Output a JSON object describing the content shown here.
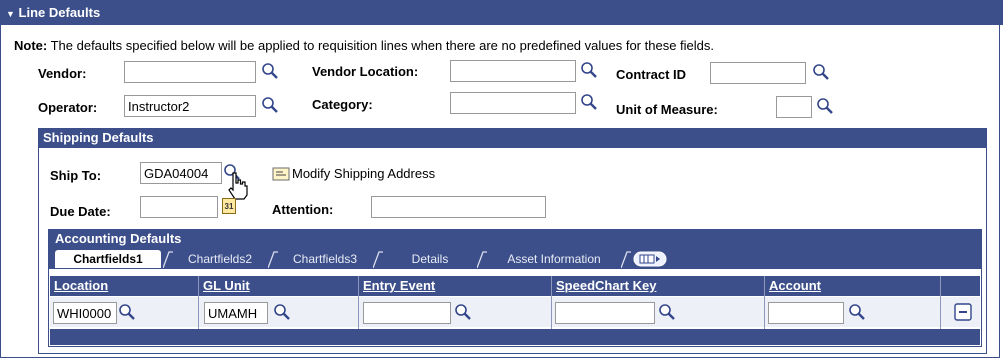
{
  "section": {
    "title": "Line Defaults",
    "toggle_icon": "triangle-down-icon"
  },
  "note": {
    "prefix": "Note:",
    "text": " The defaults specified below will be applied to requisition lines when there are no predefined values for these fields."
  },
  "fields": {
    "vendor": {
      "label": "Vendor:",
      "value": ""
    },
    "vendor_location": {
      "label": "Vendor Location:",
      "value": ""
    },
    "contract_id": {
      "label": "Contract ID",
      "value": ""
    },
    "operator": {
      "label": "Operator:",
      "value": "Instructor2"
    },
    "category": {
      "label": "Category:",
      "value": ""
    },
    "unit_of_measure": {
      "label": "Unit of Measure:",
      "value": ""
    }
  },
  "shipping": {
    "title": "Shipping Defaults",
    "ship_to_label": "Ship To:",
    "ship_to_value": "GDA04004",
    "modify_link": "Modify Shipping Address",
    "due_date_label": "Due Date:",
    "due_date_value": "",
    "calendar_badge": "31",
    "attention_label": "Attention:",
    "attention_value": ""
  },
  "accounting": {
    "title": "Accounting Defaults",
    "tabs": [
      "Chartfields1",
      "Chartfields2",
      "Chartfields3",
      "Details",
      "Asset Information"
    ],
    "active_tab": "Chartfields1",
    "columns": [
      "Location",
      "GL Unit",
      "Entry Event",
      "SpeedChart Key",
      "Account"
    ],
    "row": {
      "location": "WHI0000",
      "gl_unit": "UMAMH",
      "entry_event": "",
      "speedchart_key": "",
      "account": ""
    }
  },
  "colors": {
    "header_bg": "#3d4f8a",
    "row_bg": "#eef0f8"
  }
}
